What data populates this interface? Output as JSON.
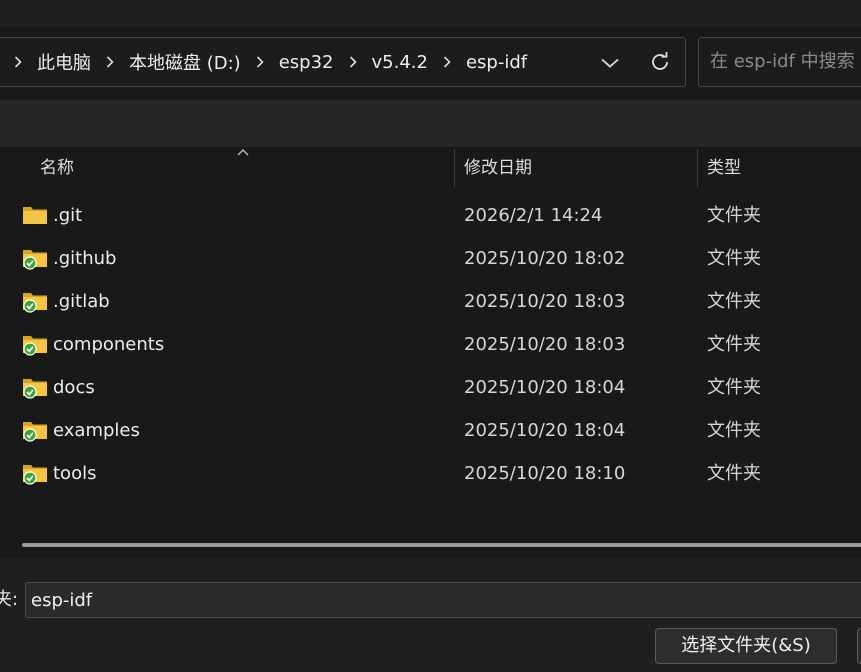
{
  "address_bar": {
    "breadcrumbs": [
      "此电脑",
      "本地磁盘 (D:)",
      "esp32",
      "v5.4.2",
      "esp-idf"
    ]
  },
  "search": {
    "placeholder": "在 esp-idf 中搜索"
  },
  "columns": {
    "name": "名称",
    "date": "修改日期",
    "type": "类型"
  },
  "files": [
    {
      "name": ".git",
      "date": "2026/2/1 14:24",
      "type": "文件夹",
      "icon": "folder-icon"
    },
    {
      "name": ".github",
      "date": "2025/10/20 18:02",
      "type": "文件夹",
      "icon": "folder-synced-icon"
    },
    {
      "name": ".gitlab",
      "date": "2025/10/20 18:03",
      "type": "文件夹",
      "icon": "folder-synced-icon"
    },
    {
      "name": "components",
      "date": "2025/10/20 18:03",
      "type": "文件夹",
      "icon": "folder-synced-icon"
    },
    {
      "name": "docs",
      "date": "2025/10/20 18:04",
      "type": "文件夹",
      "icon": "folder-synced-icon"
    },
    {
      "name": "examples",
      "date": "2025/10/20 18:04",
      "type": "文件夹",
      "icon": "folder-synced-icon"
    },
    {
      "name": "tools",
      "date": "2025/10/20 18:10",
      "type": "文件夹",
      "icon": "folder-synced-icon"
    }
  ],
  "footer": {
    "folder_label": "夹:",
    "folder_value": "esp-idf",
    "select_button": "选择文件夹(&S)"
  },
  "colors": {
    "background": "#191919",
    "folder": "#f4c542",
    "sync_check": "#3aa635"
  }
}
